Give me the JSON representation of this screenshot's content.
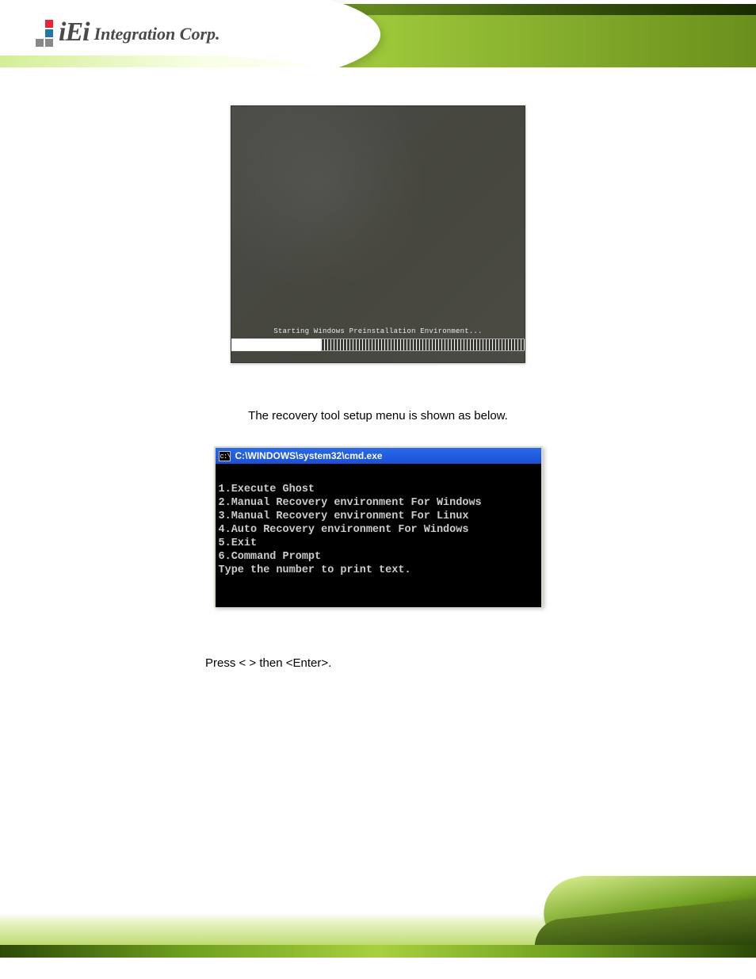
{
  "brand": {
    "logo_text": "iEi",
    "tagline": "Integration Corp."
  },
  "screenshot1": {
    "loading_text": "Starting Windows Preinstallation Environment..."
  },
  "body": {
    "line1": "The recovery tool setup menu is shown as below.",
    "line2": "Press <  > then <Enter>."
  },
  "cmd": {
    "icon_text": "c:\\",
    "title": "C:\\WINDOWS\\system32\\cmd.exe",
    "menu": [
      "1.Execute Ghost",
      "2.Manual Recovery environment For Windows",
      "3.Manual Recovery environment For Linux",
      "4.Auto Recovery environment For Windows",
      "5.Exit",
      "6.Command Prompt",
      "Type the number to print text."
    ]
  }
}
